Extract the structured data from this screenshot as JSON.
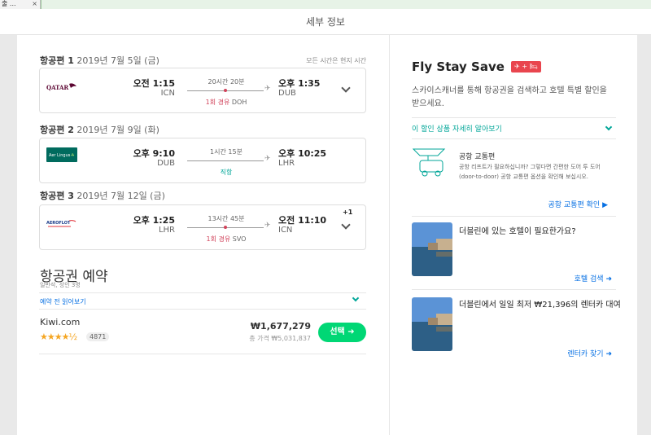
{
  "browser": {
    "tab_title": "출 ...",
    "tab_close": "×"
  },
  "modal": {
    "title": "세부 정보"
  },
  "itinerary": {
    "local_time_note": "모든 시간은 현지 시간",
    "legs": [
      {
        "label": "항공편 1",
        "date": "2019년 7월 5일 (금)",
        "airline": "QATAR",
        "airline_logo": "qatar-logo",
        "dep_time": "오전 1:15",
        "dep_code": "ICN",
        "duration": "20시간 20분",
        "stops_count": "1회 경유",
        "stops_via": "DOH",
        "arr_time": "오후 1:35",
        "arr_code": "DUB",
        "plus_day": ""
      },
      {
        "label": "항공편 2",
        "date": "2019년 7월 9일 (화)",
        "airline": "Aer Lingus",
        "airline_logo": "aer-lingus-logo",
        "dep_time": "오후 9:10",
        "dep_code": "DUB",
        "duration": "1시간 15분",
        "stops_count": "직항",
        "stops_via": "",
        "arr_time": "오후 10:25",
        "arr_code": "LHR",
        "plus_day": ""
      },
      {
        "label": "항공편 3",
        "date": "2019년 7월 12일 (금)",
        "airline": "AEROFLOT",
        "airline_logo": "aeroflot-logo",
        "dep_time": "오후 1:25",
        "dep_code": "LHR",
        "duration": "13시간 45분",
        "stops_count": "1회 경유",
        "stops_via": "SVO",
        "arr_time": "오전 11:10",
        "arr_code": "ICN",
        "plus_day": "+1"
      }
    ]
  },
  "booking": {
    "title": "항공권 예약",
    "subtitle": "일반석, 성인 3명",
    "read_first": "예약 전 읽어보기",
    "provider": "Kiwi.com",
    "rating_stars": 4.5,
    "review_count": "4871",
    "price": "₩1,677,279",
    "total": "총 가격 ₩5,031,837",
    "select_label": "선택"
  },
  "fly_stay_save": {
    "title": "Fly Stay Save",
    "badge": "✈ + 🛏",
    "description": "스카이스캐너를 통해 항공권을 검색하고 호텔 특별 할인을 받으세요.",
    "more_link": "이 할인 상품 자세히 알아보기",
    "transfer": {
      "title": "공항 교통편",
      "description": "공항 리프트가 필요하십니까? 그렇다면 간편한 도어 투 도어(door-to-door) 공항 교통편 옵션을 확인해 보십시오.",
      "link": "공항 교통편 확인"
    },
    "hotel": {
      "title": "더블린에 있는 호텔이 필요한가요?",
      "link": "호텔 검색"
    },
    "car": {
      "title": "더블린에서 일일 최저 ₩21,396의 렌터카 대여",
      "link": "렌터카 찾기"
    }
  },
  "colors": {
    "accent_green": "#00d775",
    "teal": "#00a698",
    "link_blue": "#0770e3",
    "stop_red": "#d1435b"
  }
}
